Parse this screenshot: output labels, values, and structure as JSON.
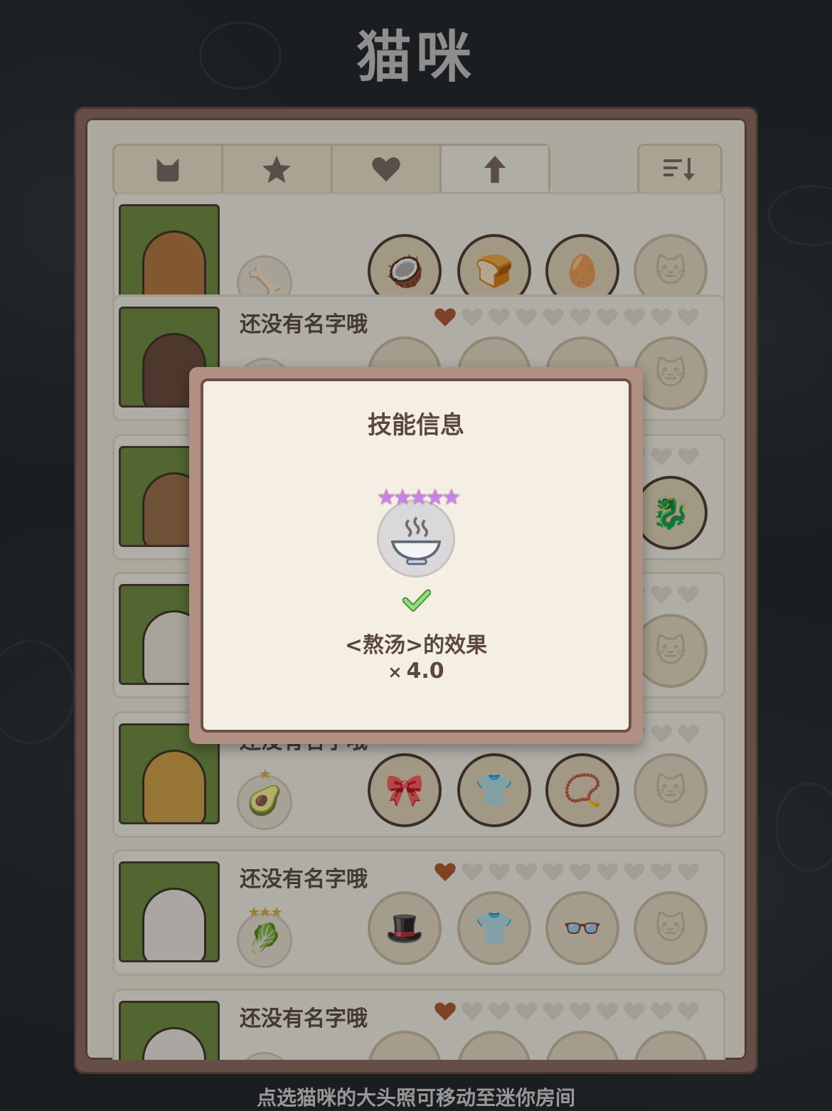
{
  "page_title": "猫咪",
  "footer_tip": "点选猫咪的大头照可移动至迷你房间",
  "tabs": [
    {
      "icon": "cat-icon",
      "active": false
    },
    {
      "icon": "star-icon",
      "active": false
    },
    {
      "icon": "heart-icon",
      "active": false
    },
    {
      "icon": "arrow-up-icon",
      "active": true
    }
  ],
  "sort_button": {
    "icon": "sort-icon"
  },
  "cats": [
    {
      "name": "",
      "hearts_filled": 0,
      "hearts_total": 0,
      "skill_icon": "bone-icon",
      "skill_glyph": "🦴",
      "skill_stars": "",
      "items": [
        {
          "glyph": "🥥",
          "empty": false
        },
        {
          "glyph": "🍞",
          "empty": false
        },
        {
          "glyph": "🥚",
          "empty": false
        },
        {
          "glyph": "🐱",
          "empty": true
        }
      ]
    },
    {
      "name": "还没有名字哦",
      "hearts_filled": 1,
      "hearts_total": 10,
      "skill_icon": "skill-icon",
      "skill_glyph": "☆",
      "skill_stars": "",
      "items": [
        {
          "glyph": "",
          "empty": true
        },
        {
          "glyph": "",
          "empty": true
        },
        {
          "glyph": "",
          "empty": true
        },
        {
          "glyph": "🐱",
          "empty": true
        }
      ]
    },
    {
      "name": "",
      "hearts_filled": 0,
      "hearts_total": 10,
      "skill_icon": "skill-icon",
      "skill_glyph": "",
      "skill_stars": "",
      "items": [
        {
          "glyph": "",
          "empty": true
        },
        {
          "glyph": "",
          "empty": true
        },
        {
          "glyph": "",
          "empty": true
        },
        {
          "glyph": "🐉",
          "empty": false
        }
      ]
    },
    {
      "name": "",
      "hearts_filled": 0,
      "hearts_total": 10,
      "skill_icon": "skill-icon",
      "skill_glyph": "",
      "skill_stars": "",
      "items": [
        {
          "glyph": "",
          "empty": true
        },
        {
          "glyph": "",
          "empty": true
        },
        {
          "glyph": "",
          "empty": true
        },
        {
          "glyph": "🐱",
          "empty": true
        }
      ]
    },
    {
      "name": "还没有名字哦",
      "hearts_filled": 1,
      "hearts_total": 10,
      "skill_icon": "avocado-icon",
      "skill_glyph": "🥑",
      "skill_stars": "★",
      "items": [
        {
          "glyph": "🎀",
          "empty": false
        },
        {
          "glyph": "👕",
          "empty": false
        },
        {
          "glyph": "📿",
          "empty": false
        },
        {
          "glyph": "🐱",
          "empty": true
        }
      ]
    },
    {
      "name": "还没有名字哦",
      "hearts_filled": 1,
      "hearts_total": 10,
      "skill_icon": "lettuce-icon",
      "skill_glyph": "🥬",
      "skill_stars": "★★★",
      "items": [
        {
          "glyph": "🎩",
          "empty": true
        },
        {
          "glyph": "👕",
          "empty": true
        },
        {
          "glyph": "👓",
          "empty": true
        },
        {
          "glyph": "🐱",
          "empty": true
        }
      ]
    },
    {
      "name": "还没有名字哦",
      "hearts_filled": 1,
      "hearts_total": 10,
      "skill_icon": "skill-icon",
      "skill_glyph": "",
      "skill_stars": "",
      "items": [
        {
          "glyph": "",
          "empty": true
        },
        {
          "glyph": "",
          "empty": true
        },
        {
          "glyph": "",
          "empty": true
        },
        {
          "glyph": "",
          "empty": true
        }
      ]
    }
  ],
  "modal": {
    "title": "技能信息",
    "skill_icon": "soup-bowl-icon",
    "skill_stars": [
      "★",
      "★",
      "★",
      "★",
      "★"
    ],
    "star_color": "#c783e6",
    "check_icon": "check-icon",
    "effect": "<熬汤>的效果",
    "multiplier_symbol": "×",
    "multiplier": "4.0"
  },
  "colors": {
    "panel_frame": "#8d6b5e",
    "panel_bg": "#f6f0e1",
    "heart_filled": "#b15a2d",
    "portrait_bg": "#6f8e3e",
    "check": "#7bd36a"
  }
}
